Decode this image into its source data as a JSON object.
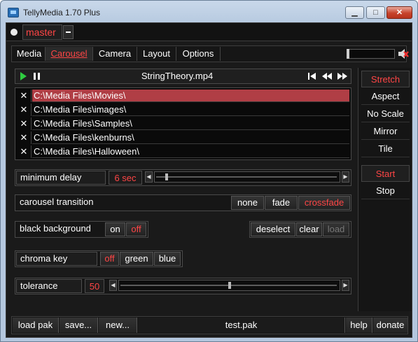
{
  "window": {
    "title": "TellyMedia 1.70 Plus",
    "controls": {
      "minimize": "▁",
      "maximize": "□",
      "close": "✕"
    }
  },
  "master": {
    "label": "master"
  },
  "nav": {
    "tabs": [
      "Media",
      "Carousel",
      "Camera",
      "Layout",
      "Options"
    ],
    "active_tab": "Carousel",
    "volume_level": 0.0
  },
  "player": {
    "filename": "StringTheory.mp4",
    "play_icon": "play-icon",
    "pause_icon": "pause-icon"
  },
  "folders": {
    "remove_glyph": "✕",
    "items": [
      "C:\\Media Files\\Movies\\",
      "C:\\Media Files\\images\\",
      "C:\\Media Files\\Samples\\",
      "C:\\Media Files\\kenburns\\",
      "C:\\Media Files\\Halloween\\"
    ],
    "selected_index": 0
  },
  "minimum_delay": {
    "label": "minimum delay",
    "value": "6 sec",
    "slider_level": 0.05
  },
  "carousel_transition": {
    "label": "carousel transition",
    "options": [
      "none",
      "fade",
      "crossfade"
    ],
    "selected": "crossfade"
  },
  "black_background": {
    "label": "black background",
    "on": "on",
    "off": "off",
    "selected": "off"
  },
  "list_actions": {
    "deselect": "deselect",
    "clear": "clear",
    "load": "load"
  },
  "chroma_key": {
    "label": "chroma key",
    "options": [
      "off",
      "green",
      "blue"
    ],
    "selected": "off"
  },
  "tolerance": {
    "label": "tolerance",
    "value": "50",
    "slider_level": 0.5
  },
  "scale_modes": {
    "options": [
      "Stretch",
      "Aspect",
      "No Scale",
      "Mirror",
      "Tile"
    ],
    "selected": "Stretch"
  },
  "playback": {
    "start": "Start",
    "stop": "Stop",
    "selected": "Start"
  },
  "bottom_bar": {
    "load_pak": "load pak",
    "save": "save...",
    "new": "new...",
    "pak_name": "test.pak",
    "help": "help",
    "donate": "donate"
  },
  "colors": {
    "accent": "#ff4545",
    "selected_row": "#b03e45",
    "background": "#1a1a1a"
  }
}
